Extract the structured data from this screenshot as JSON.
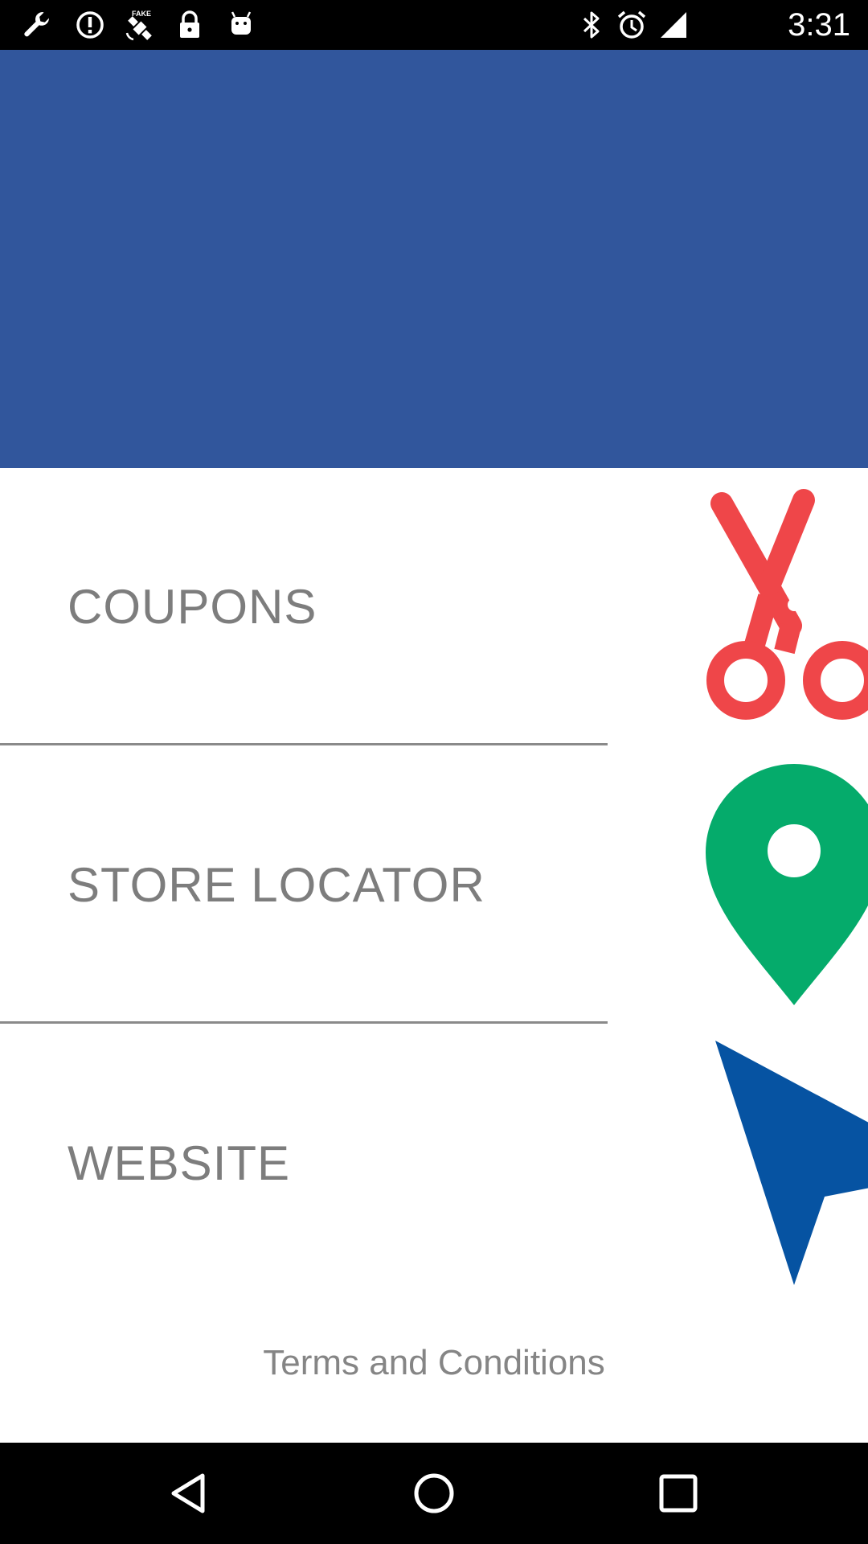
{
  "status_bar": {
    "time": "3:31",
    "left_icons": [
      "wrench-icon",
      "alert-circle-icon",
      "fake-gps-satellite-icon",
      "lock-icon",
      "android-icon"
    ],
    "right_icons": [
      "bluetooth-icon",
      "alarm-icon",
      "signal-icon"
    ]
  },
  "header": {
    "background_color": "#31569c"
  },
  "menu": {
    "items": [
      {
        "label": "COUPONS",
        "icon": "scissors-icon",
        "icon_color": "#ef4649"
      },
      {
        "label": "STORE LOCATOR",
        "icon": "map-pin-icon",
        "icon_color": "#05ab6b"
      },
      {
        "label": "WEBSITE",
        "icon": "cursor-arrow-icon",
        "icon_color": "#0653a2"
      }
    ]
  },
  "footer": {
    "terms_label": "Terms and Conditions"
  },
  "nav_bar": {
    "buttons": [
      "back-icon",
      "home-icon",
      "recents-icon"
    ]
  }
}
